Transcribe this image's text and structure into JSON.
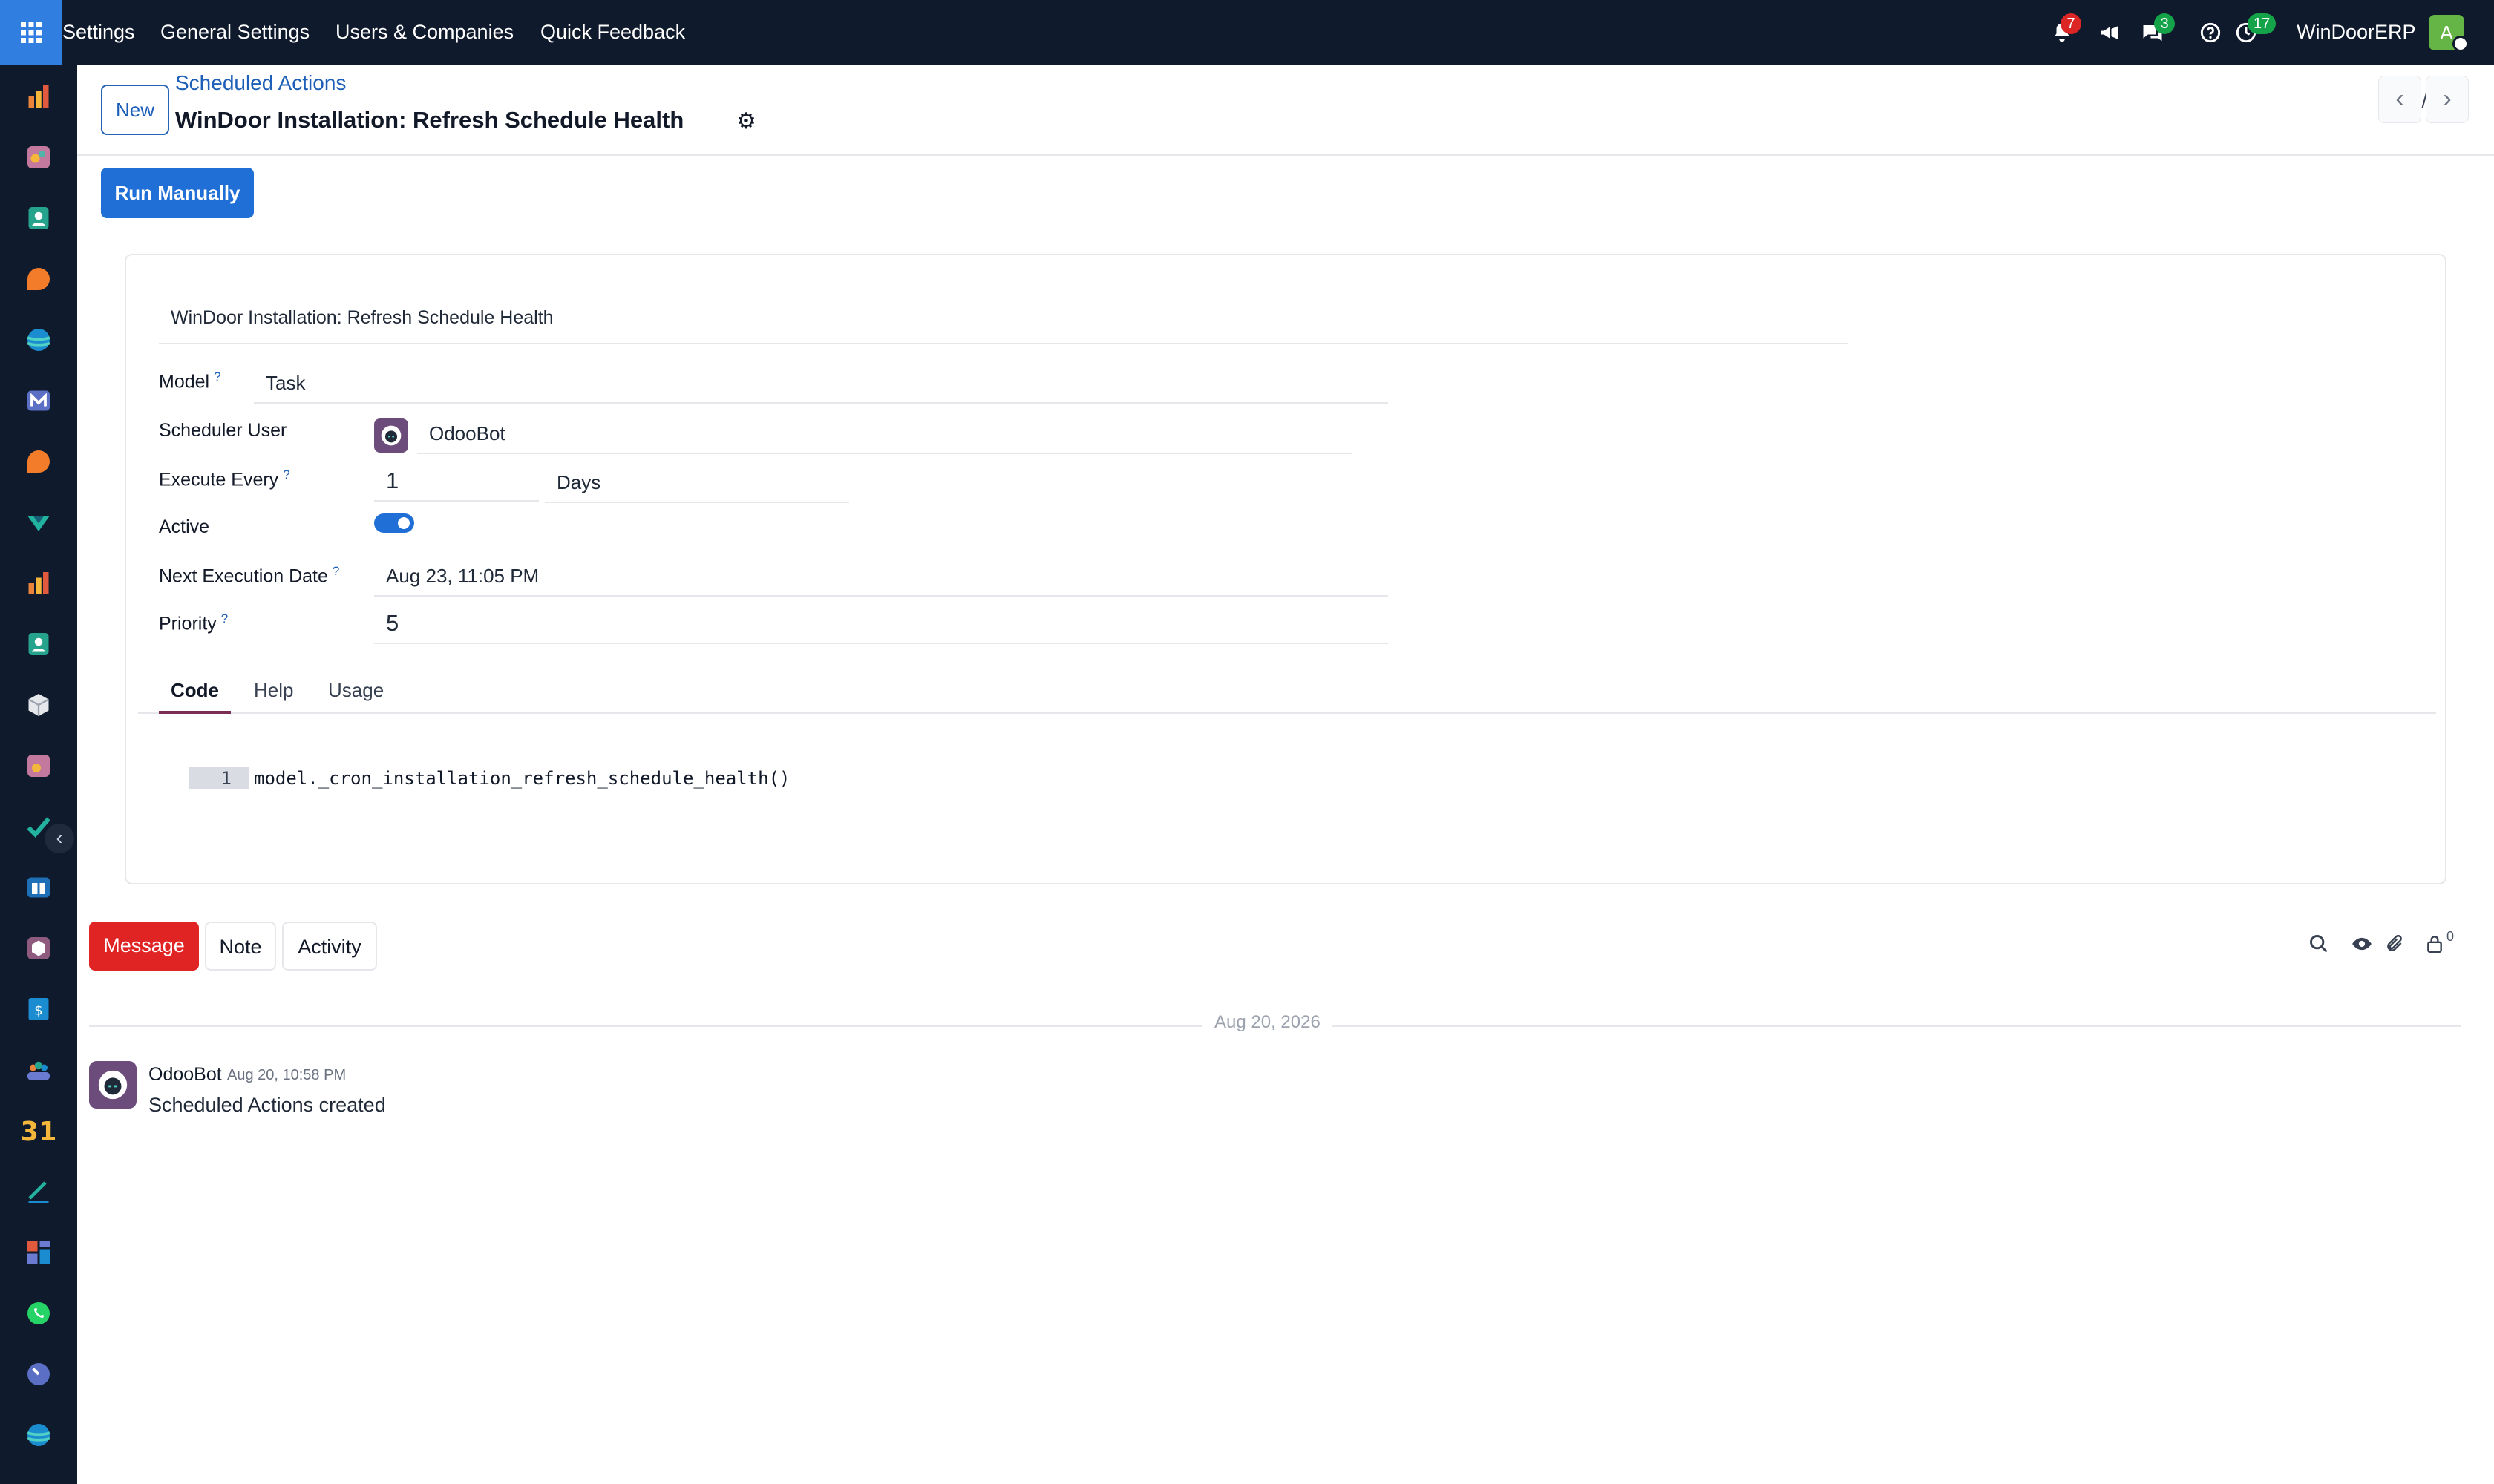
{
  "navbar": {
    "menu": [
      "Settings",
      "General Settings",
      "Users & Companies",
      "Quick Feedback"
    ],
    "notifications_badge": "7",
    "messages_badge": "3",
    "activities_badge": "17",
    "company": "WinDoorERP",
    "user_initial": "A"
  },
  "control": {
    "new_label": "New",
    "breadcrumb": "Scheduled Actions",
    "title": "WinDoor Installation: Refresh Schedule Health",
    "pager": "1 / 1"
  },
  "actions": {
    "run_manually": "Run Manually"
  },
  "form": {
    "name": "WinDoor Installation: Refresh Schedule Health",
    "model_label": "Model",
    "model_value": "Task",
    "user_label": "Scheduler User",
    "user_value": "OdooBot",
    "execute_label": "Execute Every",
    "execute_number": "1",
    "execute_unit": "Days",
    "active_label": "Active",
    "active": true,
    "next_label": "Next Execution Date",
    "next_value": "Aug 23, 11:05 PM",
    "priority_label": "Priority",
    "priority_value": "5",
    "help_mark": "?",
    "tabs": [
      "Code",
      "Help",
      "Usage"
    ],
    "code_line_number": "1",
    "code": "model._cron_installation_refresh_schedule_health()"
  },
  "chatter": {
    "message_btn": "Message",
    "note_btn": "Note",
    "activity_btn": "Activity",
    "followers_count": "0",
    "date_separator": "Aug 20, 2026",
    "messages": [
      {
        "author": "OdooBot",
        "date": "Aug 20, 10:58 PM",
        "body": "Scheduled Actions created"
      }
    ]
  },
  "colors": {
    "navbar": "#0f1a2c",
    "primary": "#1f6fd6",
    "message_button": "#e02424"
  }
}
